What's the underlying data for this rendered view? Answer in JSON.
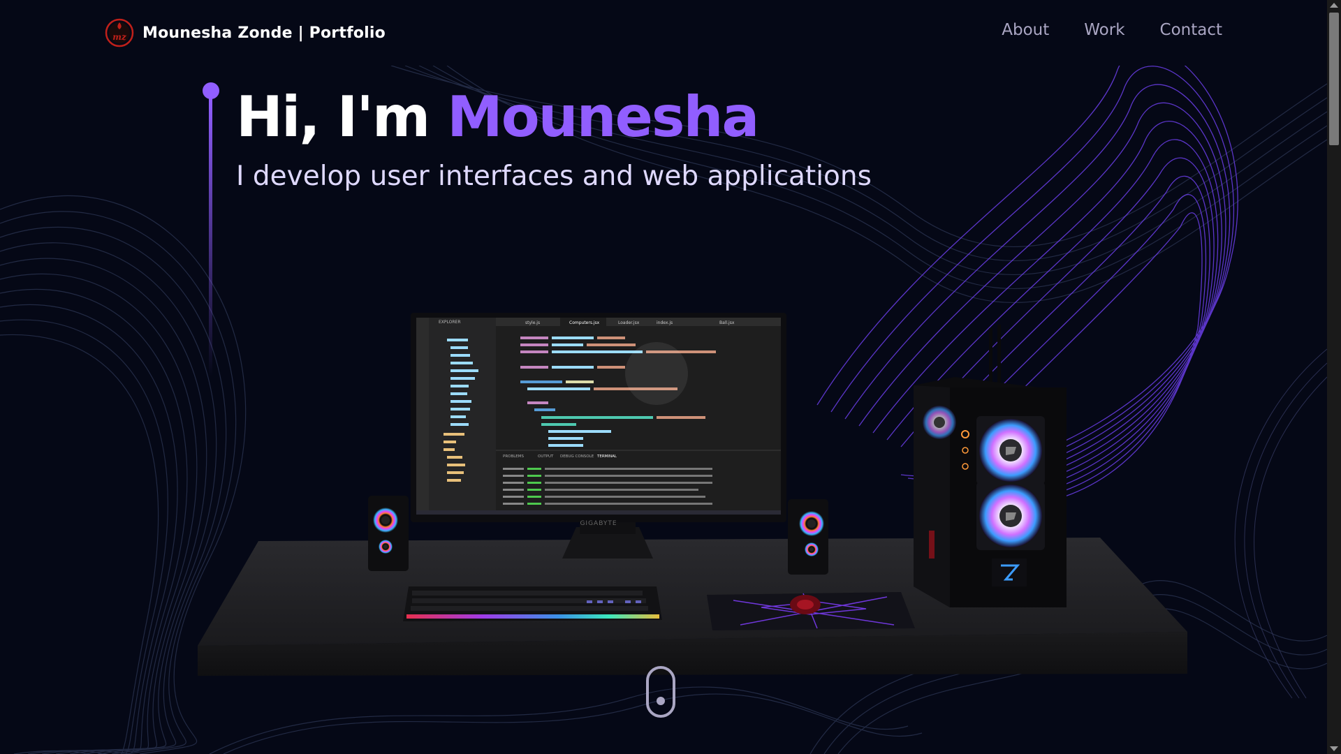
{
  "navbar": {
    "logo_text": "mz",
    "brand_name": "Mounesha Zonde",
    "brand_suffix": "| Portfolio",
    "links": [
      {
        "label": "About"
      },
      {
        "label": "Work"
      },
      {
        "label": "Contact"
      }
    ]
  },
  "hero": {
    "greeting": "Hi, I'm ",
    "name": "Mounesha",
    "subtitle": "I develop user interfaces and web applications"
  },
  "scene": {
    "monitor_brand": "GIGABYTE",
    "editor_title": "EXPLORER",
    "editor_tabs": [
      "style.js",
      "Computers.jsx",
      "Loader.jsx",
      "index.js",
      "Ball.jsx"
    ],
    "panel_tabs": [
      "PROBLEMS",
      "OUTPUT",
      "DEBUG CONSOLE",
      "TERMINAL"
    ]
  },
  "colors": {
    "background": "#050816",
    "accent": "#915eff",
    "nav_text": "#aaa6c3",
    "logo_red": "#c0201a"
  }
}
